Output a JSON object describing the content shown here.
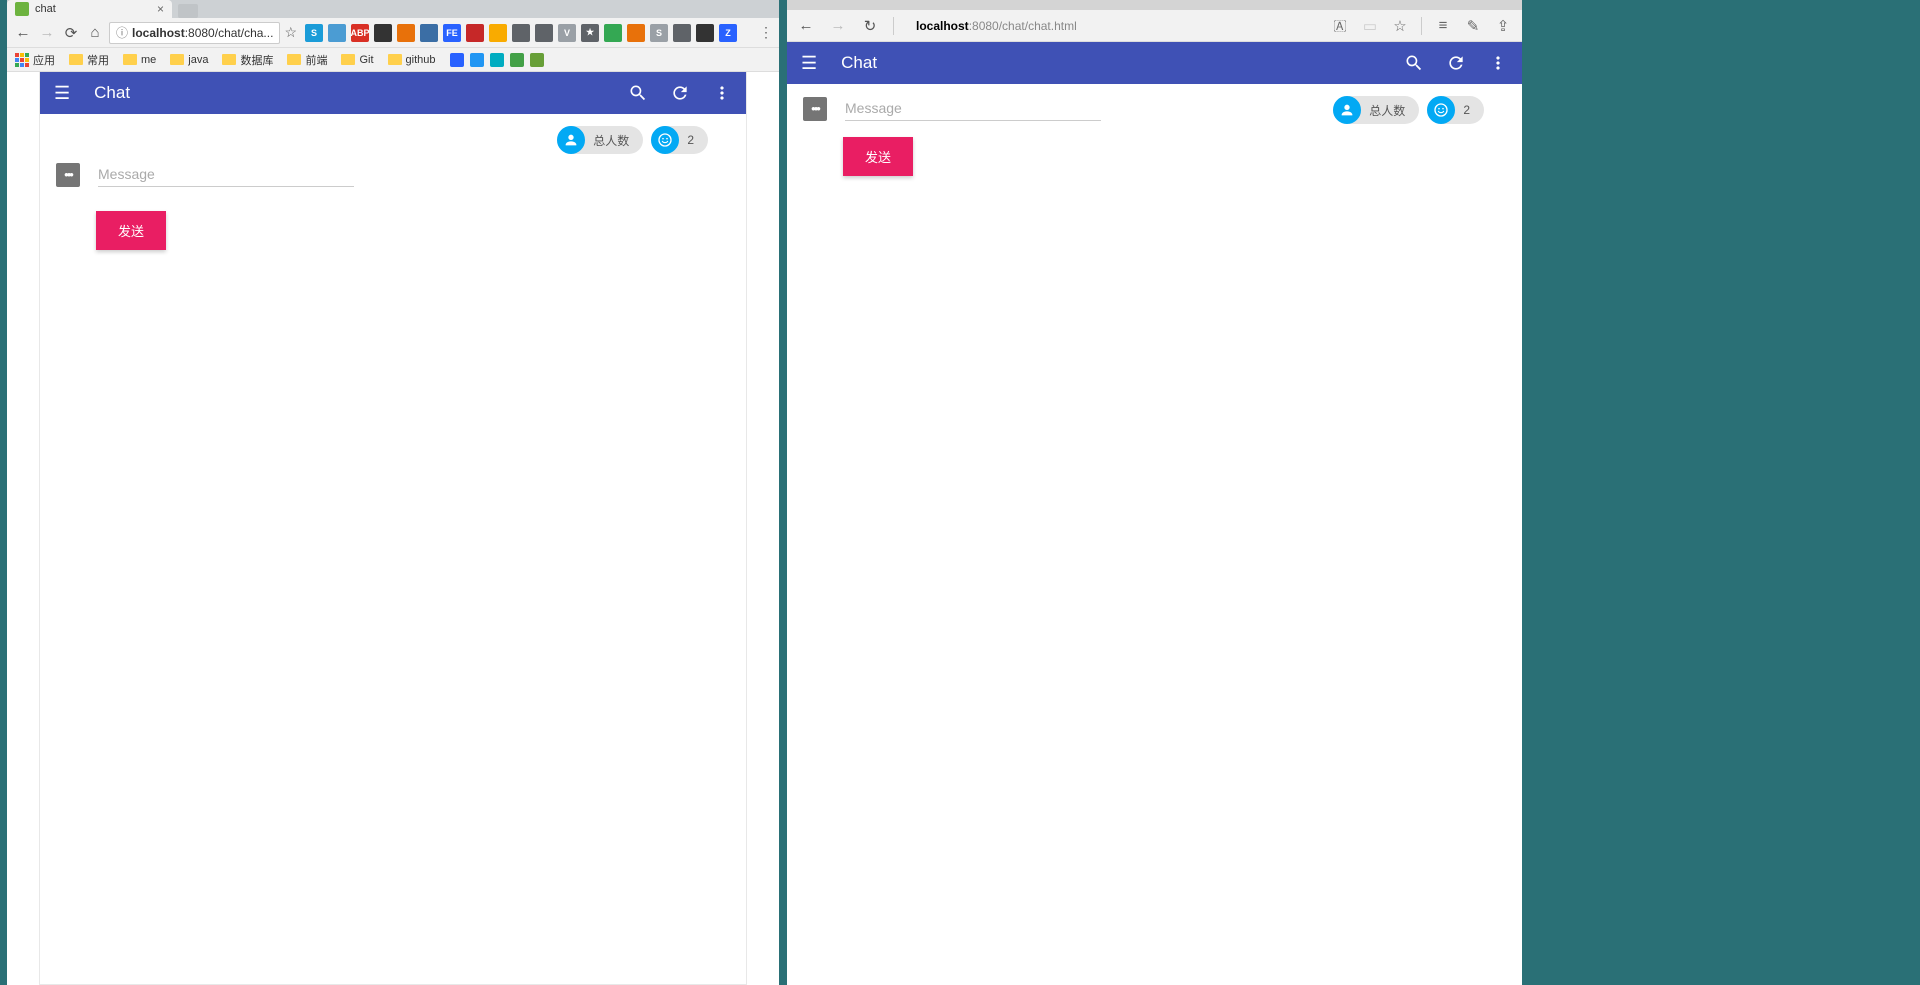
{
  "left": {
    "tab_title": "chat",
    "address": {
      "prefix": "localhost",
      "rest": ":8080/chat/cha..."
    },
    "bookmarks": [
      "应用",
      "常用",
      "me",
      "java",
      "数据库",
      "前端",
      "Git",
      "github"
    ],
    "extensions": [
      {
        "bg": "#1b9cd8",
        "label": "S"
      },
      {
        "bg": "#4b9cd3",
        "label": ""
      },
      {
        "bg": "#d93025",
        "label": "ABP"
      },
      {
        "bg": "#333",
        "label": ""
      },
      {
        "bg": "#e8710a",
        "label": ""
      },
      {
        "bg": "#3b6ea5",
        "label": ""
      },
      {
        "bg": "#2962ff",
        "label": "FE"
      },
      {
        "bg": "#c62828",
        "label": ""
      },
      {
        "bg": "#f9ab00",
        "label": ""
      },
      {
        "bg": "#5f6368",
        "label": ""
      },
      {
        "bg": "#5f6368",
        "label": ""
      },
      {
        "bg": "#9aa0a6",
        "label": "V"
      },
      {
        "bg": "#5f6368",
        "label": "★"
      },
      {
        "bg": "#34a853",
        "label": ""
      },
      {
        "bg": "#e8710a",
        "label": ""
      },
      {
        "bg": "#9aa0a6",
        "label": "S"
      },
      {
        "bg": "#5f6368",
        "label": ""
      },
      {
        "bg": "#333",
        "label": ""
      },
      {
        "bg": "#2962ff",
        "label": "Z"
      }
    ],
    "bm_tail_icons": [
      {
        "bg": "#2962ff"
      },
      {
        "bg": "#2196f3"
      },
      {
        "bg": "#00acc1"
      },
      {
        "bg": "#43a047"
      },
      {
        "bg": "#689f38"
      }
    ],
    "app_title": "Chat",
    "chips": [
      {
        "label": "总人数"
      },
      {
        "label": "2"
      }
    ],
    "message_placeholder": "Message",
    "send_label": "发送"
  },
  "right": {
    "address": {
      "prefix": "localhost",
      "rest": ":8080/chat/chat.html"
    },
    "app_title": "Chat",
    "chips": [
      {
        "label": "总人数"
      },
      {
        "label": "2"
      }
    ],
    "message_placeholder": "Message",
    "send_label": "发送"
  }
}
